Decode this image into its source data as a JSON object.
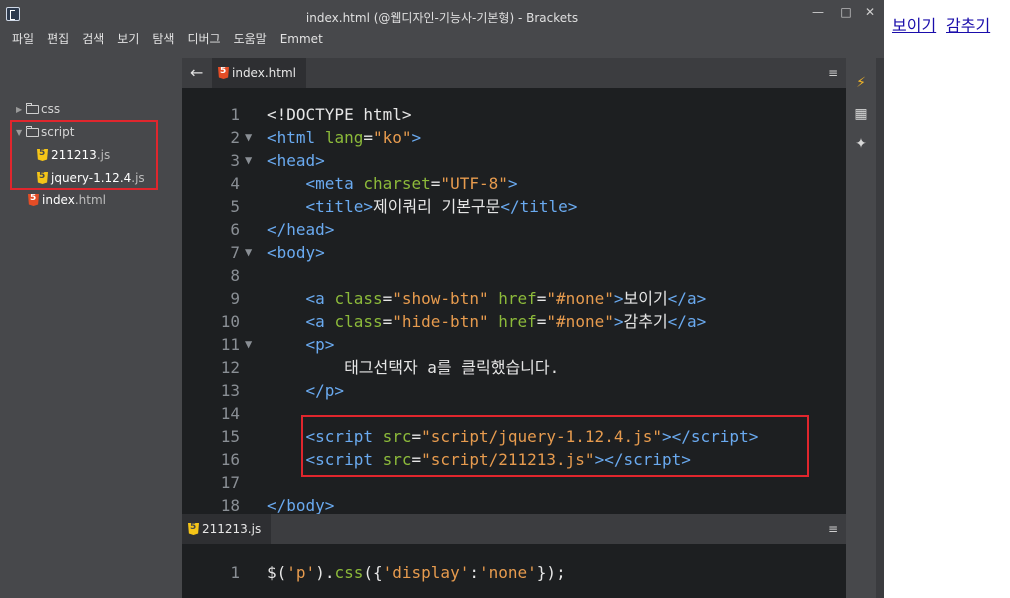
{
  "window": {
    "title": "index.html (@웹디자인-기능사-기본형) - Brackets",
    "controls": [
      "—",
      "□",
      "✕"
    ]
  },
  "menu": [
    "파일",
    "편집",
    "검색",
    "보기",
    "탐색",
    "디버그",
    "도움말",
    "Emmet"
  ],
  "sidebar": {
    "css_folder": "css",
    "script_folder": "script",
    "files": [
      {
        "name": "211213",
        "ext": ".js"
      },
      {
        "name": "jquery-1.12.4",
        "ext": ".js"
      }
    ],
    "index_file": {
      "name": "index",
      "ext": ".html"
    }
  },
  "editor_top": {
    "tab_label": "index.html",
    "lines": [
      {
        "n": "1",
        "fold": ""
      },
      {
        "n": "2",
        "fold": "▼"
      },
      {
        "n": "3",
        "fold": "▼"
      },
      {
        "n": "4",
        "fold": ""
      },
      {
        "n": "5",
        "fold": ""
      },
      {
        "n": "6",
        "fold": ""
      },
      {
        "n": "7",
        "fold": "▼"
      },
      {
        "n": "8",
        "fold": ""
      },
      {
        "n": "9",
        "fold": ""
      },
      {
        "n": "10",
        "fold": ""
      },
      {
        "n": "11",
        "fold": "▼"
      },
      {
        "n": "12",
        "fold": ""
      },
      {
        "n": "13",
        "fold": ""
      },
      {
        "n": "14",
        "fold": ""
      },
      {
        "n": "15",
        "fold": ""
      },
      {
        "n": "16",
        "fold": ""
      },
      {
        "n": "17",
        "fold": ""
      },
      {
        "n": "18",
        "fold": ""
      }
    ],
    "code": {
      "l1": "<!DOCTYPE html>",
      "html_lang": "ko",
      "charset": "UTF-8",
      "title_text": "제이쿼리 기본구문",
      "show_class": "show-btn",
      "show_href": "#none",
      "show_text": "보이기",
      "hide_class": "hide-btn",
      "hide_href": "#none",
      "hide_text": "감추기",
      "p_text": "태그선택자 a를 클릭했습니다.",
      "src1": "script/jquery-1.12.4.js",
      "src2": "script/211213.js"
    }
  },
  "editor_bottom": {
    "tab_label": "211213.js",
    "line_number": "1",
    "selector": "p",
    "prop": "display",
    "value": "none"
  },
  "preview": {
    "show_link": "보이기",
    "hide_link": "감추기"
  },
  "colors": {
    "highlight_box": "#e0262d",
    "tag": "#6aaaf0",
    "attr": "#8cba3a",
    "string": "#e79b4e"
  }
}
